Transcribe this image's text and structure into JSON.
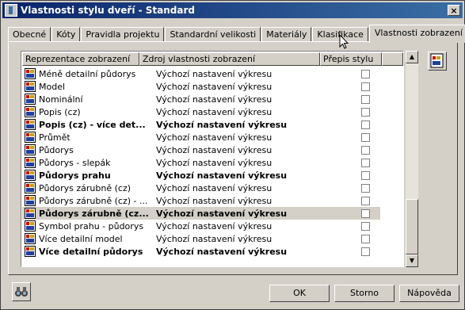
{
  "window": {
    "title": "Vlastnosti stylu dveří - Standard",
    "close_glyph": "×"
  },
  "tabs": [
    {
      "label": "Obecné",
      "active": false
    },
    {
      "label": "Kóty",
      "active": false
    },
    {
      "label": "Pravidla projektu",
      "active": false
    },
    {
      "label": "Standardní velikosti",
      "active": false
    },
    {
      "label": "Materiály",
      "active": false
    },
    {
      "label": "Klasifikace",
      "active": false
    },
    {
      "label": "Vlastnosti zobrazení",
      "active": true
    }
  ],
  "grid": {
    "headers": [
      "Reprezentace zobrazení",
      "Zdroj vlastnosti zobrazení",
      "Přepis stylu"
    ],
    "rows": [
      {
        "name": "Méně detailní půdorys",
        "source": "Výchozí nastavení výkresu",
        "bold": false,
        "override": false,
        "selected": false
      },
      {
        "name": "Model",
        "source": "Výchozí nastavení výkresu",
        "bold": false,
        "override": false,
        "selected": false
      },
      {
        "name": "Nominální",
        "source": "Výchozí nastavení výkresu",
        "bold": false,
        "override": false,
        "selected": false
      },
      {
        "name": "Popis (cz)",
        "source": "Výchozí nastavení výkresu",
        "bold": false,
        "override": false,
        "selected": false
      },
      {
        "name": "Popis (cz) - více det...",
        "source": "Výchozí nastavení výkresu",
        "bold": true,
        "override": false,
        "selected": false
      },
      {
        "name": "Průmět",
        "source": "Výchozí nastavení výkresu",
        "bold": false,
        "override": false,
        "selected": false
      },
      {
        "name": "Půdorys",
        "source": "Výchozí nastavení výkresu",
        "bold": false,
        "override": false,
        "selected": false
      },
      {
        "name": "Půdorys - slepák",
        "source": "Výchozí nastavení výkresu",
        "bold": false,
        "override": false,
        "selected": false
      },
      {
        "name": "Půdorys prahu",
        "source": "Výchozí nastavení výkresu",
        "bold": true,
        "override": false,
        "selected": false
      },
      {
        "name": "Půdorys zárubně (cz)",
        "source": "Výchozí nastavení výkresu",
        "bold": false,
        "override": false,
        "selected": false
      },
      {
        "name": "Půdorys zárubně (cz) - ...",
        "source": "Výchozí nastavení výkresu",
        "bold": false,
        "override": false,
        "selected": false
      },
      {
        "name": "Půdorys zárubně (cz...",
        "source": "Výchozí nastavení výkresu",
        "bold": true,
        "override": false,
        "selected": true
      },
      {
        "name": "Symbol prahu - půdorys",
        "source": "Výchozí nastavení výkresu",
        "bold": false,
        "override": false,
        "selected": false
      },
      {
        "name": "Více detailní model",
        "source": "Výchozí nastavení výkresu",
        "bold": false,
        "override": false,
        "selected": false
      },
      {
        "name": "Více detailní půdorys",
        "source": "Výchozí nastavení výkresu",
        "bold": true,
        "override": false,
        "selected": false
      }
    ],
    "row_icon": "display-representation-icon"
  },
  "scrollbar": {
    "up_glyph": "▲",
    "down_glyph": "▼"
  },
  "side_button": {
    "icon": "edit-display-properties-icon"
  },
  "footer": {
    "help_icon": "binoculars-icon",
    "ok_label": "OK",
    "cancel_label": "Storno",
    "help_label": "Nápověda"
  },
  "colors": {
    "titlebar_start": "#0a246a",
    "titlebar_end": "#3a6ea5",
    "face": "#d4d0c8",
    "selected_row": "#d4d0c8"
  }
}
